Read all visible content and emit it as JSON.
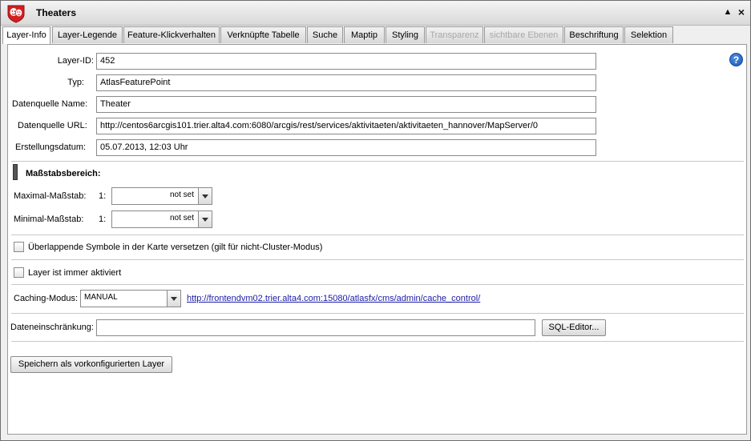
{
  "window": {
    "title": "Theaters",
    "collapse_glyph": "▲",
    "close_glyph": "×"
  },
  "tabs": [
    {
      "label": "Layer-Info",
      "state": "active"
    },
    {
      "label": "Layer-Legende",
      "state": "normal"
    },
    {
      "label": "Feature-Klickverhalten",
      "state": "normal"
    },
    {
      "label": "Verknüpfte Tabelle",
      "state": "normal"
    },
    {
      "label": "Suche",
      "state": "normal"
    },
    {
      "label": "Maptip",
      "state": "normal"
    },
    {
      "label": "Styling",
      "state": "normal"
    },
    {
      "label": "Transparenz",
      "state": "disabled"
    },
    {
      "label": "sichtbare Ebenen",
      "state": "disabled"
    },
    {
      "label": "Beschriftung",
      "state": "normal"
    },
    {
      "label": "Selektion",
      "state": "normal"
    }
  ],
  "info": {
    "layer_id_label": "Layer-ID:",
    "layer_id": "452",
    "typ_label": "Typ:",
    "typ": "AtlasFeaturePoint",
    "ds_name_label": "Datenquelle Name:",
    "ds_name": "Theater",
    "ds_url_label": "Datenquelle URL:",
    "ds_url": "http://centos6arcgis101.trier.alta4.com:6080/arcgis/rest/services/aktivitaeten/aktivitaeten_hannover/MapServer/0",
    "created_label": "Erstellungsdatum:",
    "created": "05.07.2013, 12:03 Uhr"
  },
  "scale": {
    "section_title": "Maßstabsbereich:",
    "max_label": "Maximal-Maßstab:",
    "max_prefix": "1:",
    "max_value": "not set",
    "min_label": "Minimal-Maßstab:",
    "min_prefix": "1:",
    "min_value": "not set"
  },
  "options": {
    "overlap_label": "Überlappende Symbole in der Karte versetzen (gilt für nicht-Cluster-Modus)",
    "overlap_checked": false,
    "always_active_label": "Layer ist immer aktiviert",
    "always_active_checked": false
  },
  "caching": {
    "label": "Caching-Modus:",
    "value": "MANUAL",
    "link": "http://frontendvm02.trier.alta4.com:15080/atlasfx/cms/admin/cache_control/"
  },
  "filter": {
    "label": "Dateneinschränkung:",
    "value": "",
    "sql_button": "SQL-Editor..."
  },
  "save_button": "Speichern als vorkonfigurierten Layer",
  "colors": {
    "link": "#1a1aa8",
    "help_icon": "#1a56b8",
    "app_icon": "#d42020",
    "disabled_tab": "#a8a8a8"
  },
  "icons": {
    "app": "theater-masks-icon",
    "help": "help-icon",
    "collapse": "collapse-icon",
    "close": "close-icon"
  }
}
